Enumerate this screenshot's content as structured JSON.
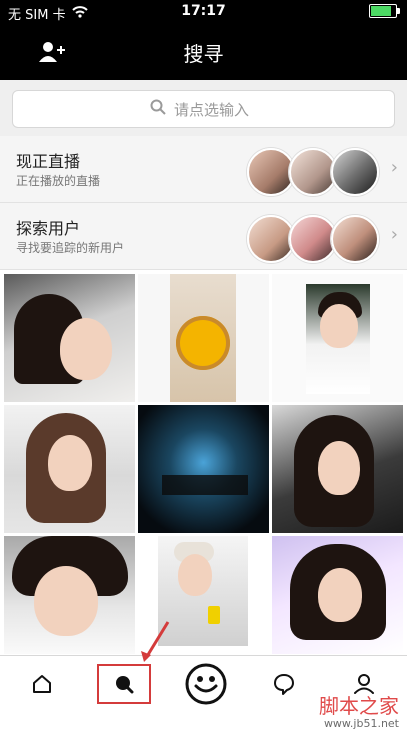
{
  "status": {
    "carrier": "无 SIM 卡",
    "time": "17:17",
    "battery_percent": 85
  },
  "header": {
    "title": "搜寻",
    "add_user_icon": "add-user-icon"
  },
  "search": {
    "placeholder": "请点选输入",
    "icon": "search-icon"
  },
  "rows": [
    {
      "title": "现正直播",
      "subtitle": "正在播放的直播"
    },
    {
      "title": "探索用户",
      "subtitle": "寻找要追踪的新用户"
    }
  ],
  "tabs": [
    {
      "name": "home-icon"
    },
    {
      "name": "search-icon"
    },
    {
      "name": "live-icon"
    },
    {
      "name": "chat-icon"
    },
    {
      "name": "profile-icon"
    }
  ],
  "watermark": {
    "text": "脚本之家",
    "url": "www.jb51.net"
  },
  "colors": {
    "header_bg": "#000000",
    "highlight": "#d43b3b"
  }
}
